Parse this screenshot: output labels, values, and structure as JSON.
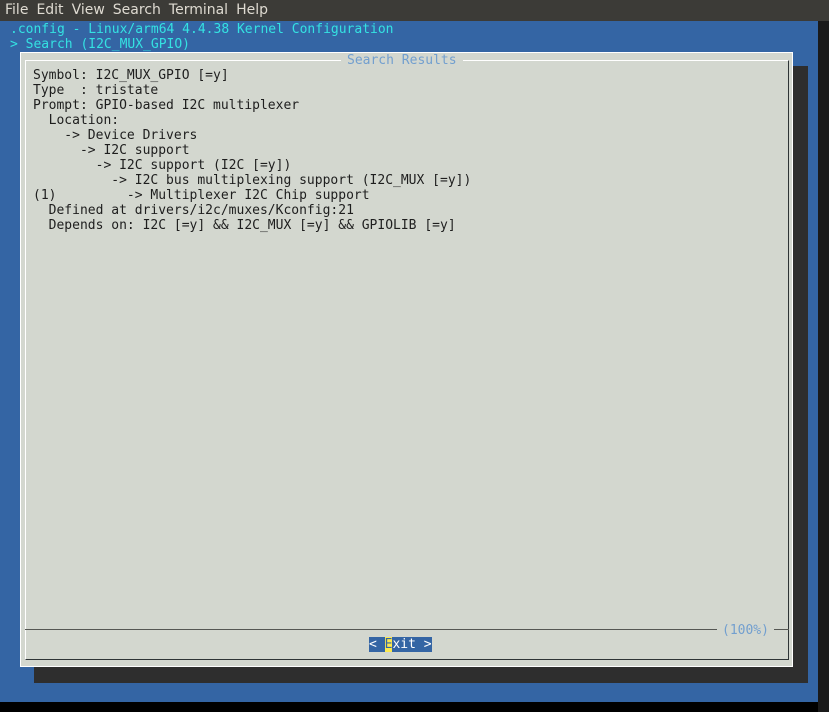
{
  "menubar": {
    "items": [
      "File",
      "Edit",
      "View",
      "Search",
      "Terminal",
      "Help"
    ]
  },
  "header": {
    "title": ".config - Linux/arm64 4.4.38 Kernel Configuration",
    "breadcrumb": "> Search (I2C_MUX_GPIO) "
  },
  "dialog": {
    "title": "Search Results",
    "lines": [
      "Symbol: I2C_MUX_GPIO [=y]",
      "Type  : tristate",
      "Prompt: GPIO-based I2C multiplexer",
      "  Location:",
      "    -> Device Drivers",
      "      -> I2C support",
      "        -> I2C support (I2C [=y])",
      "          -> I2C bus multiplexing support (I2C_MUX [=y])",
      "(1)         -> Multiplexer I2C Chip support",
      "  Defined at drivers/i2c/muxes/Kconfig:21",
      "  Depends on: I2C [=y] && I2C_MUX [=y] && GPIOLIB [=y]"
    ],
    "scroll_percent": "(100%)",
    "exit_button": {
      "left": "< ",
      "hotkey": "E",
      "rest": "xit >"
    }
  },
  "colors": {
    "screen_background": "#3465a4",
    "dialog_background": "#d3d7cf",
    "title_text": "#34e2e2",
    "dialog_title": "#729fcf",
    "hotkey": "#fce94f"
  }
}
